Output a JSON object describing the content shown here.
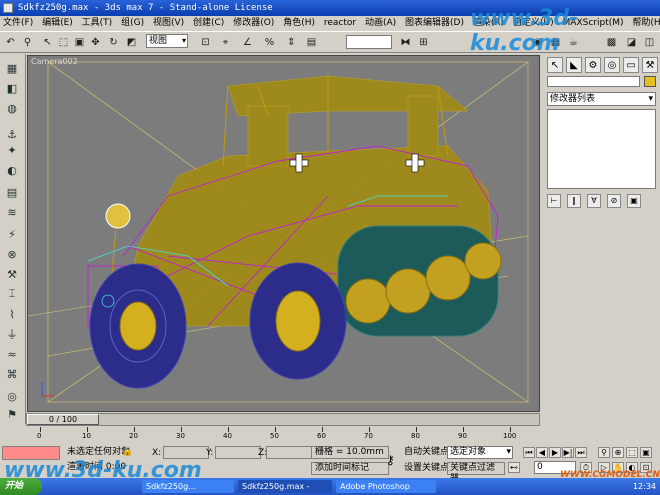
{
  "window": {
    "title": "Sdkfz250g.max - 3ds max 7  - Stand-alone License"
  },
  "menu": [
    "文件(F)",
    "编辑(E)",
    "工具(T)",
    "组(G)",
    "视图(V)",
    "创建(C)",
    "修改器(O)",
    "角色(H)",
    "reactor",
    "动画(A)",
    "图表编辑器(D)",
    "渲染(R)",
    "自定义(U)",
    "MAXScript(M)",
    "帮助(H)"
  ],
  "toolbar": {
    "view_dropdown": "视图"
  },
  "viewport": {
    "label": "Camera002"
  },
  "command_panel": {
    "modifier_list": "修改器列表"
  },
  "time_slider": {
    "label": "0 / 100"
  },
  "track_bar": {
    "ticks": [
      "0",
      "10",
      "20",
      "30",
      "40",
      "50",
      "60",
      "70",
      "80",
      "90",
      "100"
    ]
  },
  "status": {
    "selection": "未选定任何对象",
    "prompt": "渲署时间 0:00",
    "x_label": "X:",
    "y_label": "Y:",
    "z_label": "Z:",
    "grid": "栅格 = 10.0mm",
    "add_time_tag": "添加时间标记",
    "auto_key": "自动关键点",
    "set_key": "设置关键点",
    "selection_set": "选定对象",
    "key_filters": "关键点过滤器...",
    "frame": "0"
  },
  "taskbar": {
    "start": "开始",
    "tasks": [
      "Sdkfz250g...",
      "Sdkfz250g.max -",
      "Adobe Photoshop"
    ],
    "clock": "12:34"
  },
  "watermarks": [
    "www.3d-ku.com",
    "www.3d-ku.com",
    "WWW.CGMODEL.CN"
  ]
}
